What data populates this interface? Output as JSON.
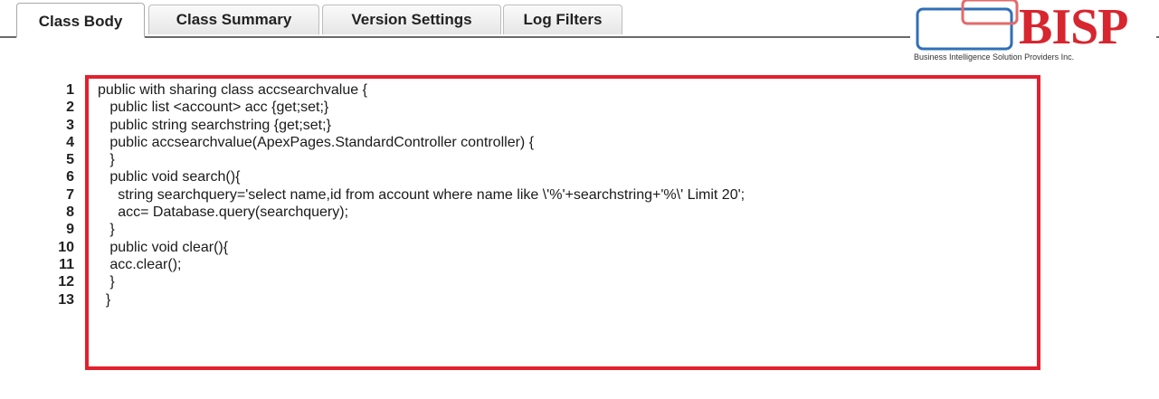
{
  "tabs": [
    {
      "label": "Class Body",
      "active": true
    },
    {
      "label": "Class Summary",
      "active": false
    },
    {
      "label": "Version Settings",
      "active": false
    },
    {
      "label": "Log Filters",
      "active": false
    }
  ],
  "logo": {
    "text": "BISP",
    "tagline": "Business Intelligence Solution Providers Inc.",
    "colors": {
      "text": "#d7262f",
      "blue_box": "#2f6fb8",
      "red_box": "#e36a6a"
    }
  },
  "highlight_color": "#e3202e",
  "code": {
    "line_numbers": [
      "1",
      "2",
      "3",
      "4",
      "5",
      "6",
      "7",
      "8",
      "9",
      "10",
      "11",
      "12",
      "13"
    ],
    "lines": [
      "public with sharing class accsearchvalue {",
      "   public list <account> acc {get;set;}",
      "   public string searchstring {get;set;}",
      "   public accsearchvalue(ApexPages.StandardController controller) {",
      "   }",
      "   public void search(){",
      "     string searchquery='select name,id from account where name like \\'%'+searchstring+'%\\' Limit 20';",
      "     acc= Database.query(searchquery);",
      "   }",
      "   public void clear(){",
      "   acc.clear();",
      "   }",
      "  }"
    ]
  }
}
